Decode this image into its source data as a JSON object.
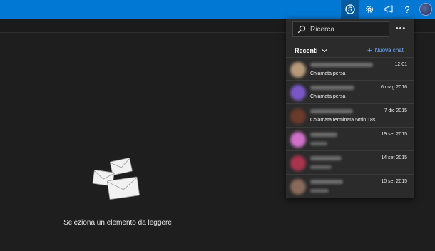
{
  "topbar": {
    "icons": [
      "skype-icon",
      "gear-icon",
      "megaphone-icon",
      "help-icon",
      "avatar"
    ],
    "help_label": "?",
    "accent": "#0078d4"
  },
  "empty_state": {
    "message": "Seleziona un elemento da leggere"
  },
  "skype_panel": {
    "search": {
      "placeholder": "Ricerca",
      "value": ""
    },
    "more_label": "•••",
    "recent_label": "Recenti",
    "new_chat_label": "Nuova chat",
    "chats": [
      {
        "time": "12:01",
        "subtitle": "Chiamata persa",
        "avatar_color": "#b79a7a"
      },
      {
        "time": "6 mag 2016",
        "subtitle": "Chiamata persa",
        "avatar_color": "#7a57c8"
      },
      {
        "time": "7 dic 2015",
        "subtitle": "Chiamata terminata 5min 18s",
        "avatar_color": "#6a3a2a"
      },
      {
        "time": "19 set 2015",
        "subtitle": "",
        "avatar_color": "#d070c8"
      },
      {
        "time": "14 set 2015",
        "subtitle": "",
        "avatar_color": "#a8344e"
      },
      {
        "time": "10 set 2015",
        "subtitle": "",
        "avatar_color": "#8a6a5a"
      }
    ]
  }
}
